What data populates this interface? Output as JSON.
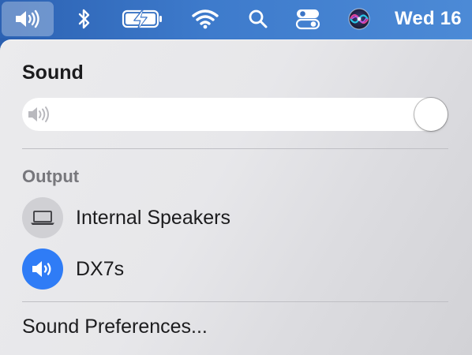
{
  "menubar": {
    "items": [
      {
        "icon": "speaker-icon",
        "active": true
      },
      {
        "icon": "bluetooth-icon"
      },
      {
        "icon": "battery-charging-icon"
      },
      {
        "icon": "wifi-icon"
      },
      {
        "icon": "search-icon"
      },
      {
        "icon": "control-center-icon"
      },
      {
        "icon": "siri-icon"
      }
    ],
    "clock": "Wed 16"
  },
  "panel": {
    "title": "Sound",
    "volume": {
      "level": 1.0,
      "icon": "speaker-low-icon"
    },
    "output_label": "Output",
    "devices": [
      {
        "label": "Internal Speakers",
        "icon": "laptop-icon",
        "selected": false
      },
      {
        "label": "DX7s",
        "icon": "speaker-icon",
        "selected": true
      }
    ],
    "preferences_label": "Sound Preferences..."
  },
  "colors": {
    "menubar": "#3a76c8",
    "accent": "#2f7cf6",
    "panel": "#e7e7ea",
    "text": "#1c1c1e",
    "section_label": "#77777c"
  }
}
